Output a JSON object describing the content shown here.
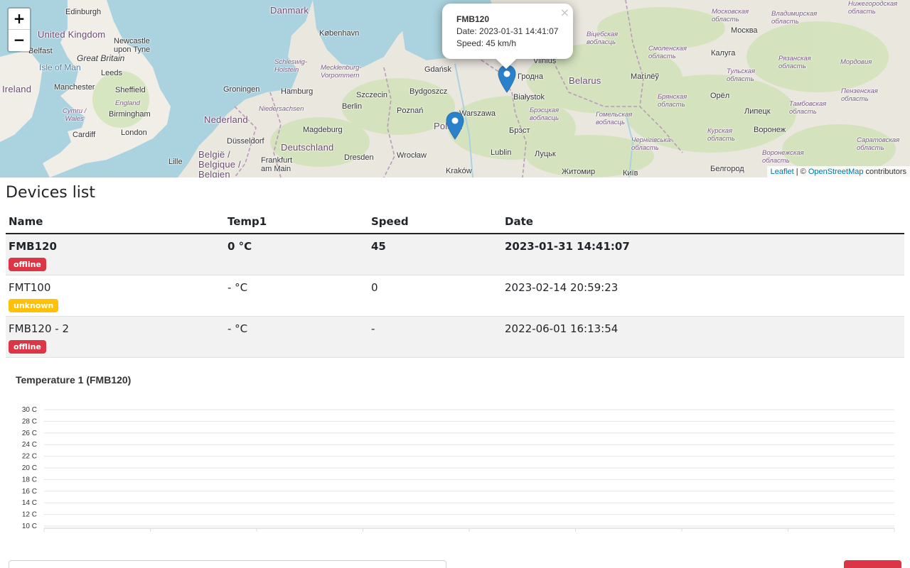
{
  "map": {
    "zoom_in": "+",
    "zoom_out": "−",
    "labels": {
      "edinburgh": "Edinburgh",
      "united_kingdom": "United Kingdom",
      "newcastle": "Newcastle\nupon Tyne",
      "belfast": "Belfast",
      "great_britain": "Great Britain",
      "isle_of_man": "Isle of Man",
      "leeds": "Leeds",
      "ireland": "Ireland",
      "manchester": "Manchester",
      "sheffield": "Sheffield",
      "cymru": "Cymru /\nWales",
      "england": "England",
      "birmingham": "Birmingham",
      "cardiff": "Cardiff",
      "london": "London",
      "lille": "Lille",
      "belgie": "België /\nBelgique /\nBelgien",
      "danmark": "Danmark",
      "kobenhavn": "København",
      "schleswig": "Schleswig-\nHolstein",
      "mecklenburg": "Mecklenburg-\nVorpommern",
      "groningen": "Groningen",
      "hamburg": "Hamburg",
      "szczecin": "Szczecin",
      "niedersachsen": "Niedersachsen",
      "berlin": "Berlin",
      "nederland": "Nederland",
      "magdeburg": "Magdeburg",
      "dusseldorf": "Düsseldorf",
      "deutschland": "Deutschland",
      "frankfurt": "Frankfurt\nam Main",
      "dresden": "Dresden",
      "gdansk": "Gdańsk",
      "bydgoszcz": "Bydgoszcz",
      "poznan": "Poznań",
      "warszawa": "Warszawa",
      "polska": "Polska",
      "wroclaw": "Wrocław",
      "krakow": "Kraków",
      "lublin": "Lublin",
      "vilnius": "Vilnius",
      "grodna": "Гродна",
      "bialystok": "Białystok",
      "belarus": "Belarus",
      "brest": "Брэст",
      "brestskaya": "Брэсцкая\nвобласць",
      "lutsk": "Луцьк",
      "zhytomyr": "Житомир",
      "kyiv": "Київ",
      "vitebsk": "Віцебская\nвобласць",
      "mahilyow": "Магілёў",
      "gomel": "Гомельская\nвобласць",
      "chernihiv": "Чернігівська\nобласть",
      "smolensk": "Смоленская\nобласть",
      "moskva": "Москва",
      "kaluga": "Калуга",
      "orel": "Орёл",
      "lipetsk": "Липецк",
      "voronezh": "Воронеж",
      "bryansk": "Брянская\nобласть",
      "kursk": "Курская\nобласть",
      "tula": "Тульская\nобласть",
      "ryazan": "Рязанская\nобласть",
      "tambov": "Тамбовская\nобласть",
      "penza": "Пензенская\nобласть",
      "vladimir": "Владимирская\nобласть",
      "nizhegorod": "Нижегородская\nобласть",
      "mordovia": "Мордовия",
      "voronezh_obl": "Воронежская\nобласть",
      "saratov": "Саратовская\nобласть",
      "belgorod": "Белгород",
      "moskovskaya": "Московская\nобласть"
    },
    "popup": {
      "name": "FMB120",
      "date_line": "Date: 2023-01-31 14:41:07",
      "speed_line": "Speed: 45 km/h",
      "close": "×"
    },
    "attribution": {
      "leaflet": "Leaflet",
      "sep": " | © ",
      "osm": "OpenStreetMap",
      "suffix": " contributors"
    },
    "marker_color": "#2a81cb"
  },
  "devices": {
    "title": "Devices list",
    "columns": [
      "Name",
      "Temp1",
      "Speed",
      "Date"
    ],
    "rows": [
      {
        "name": "FMB120",
        "temp": "0 °C",
        "speed": "45",
        "date": "2023-01-31 14:41:07",
        "status": "offline"
      },
      {
        "name": "FMT100",
        "temp": "- °C",
        "speed": "0",
        "date": "2023-02-14 20:59:23",
        "status": "unknown"
      },
      {
        "name": "FMB120 - 2",
        "temp": "- °C",
        "speed": "-",
        "date": "2022-06-01 16:13:54",
        "status": "offline"
      }
    ]
  },
  "chart_title": "Temperature 1 (FMB120)",
  "chart_data": {
    "type": "line",
    "title": "Temperature 1 (FMB120)",
    "y_ticks": [
      "30 C",
      "28 C",
      "26 C",
      "24 C",
      "22 C",
      "20 C",
      "18 C",
      "16 C",
      "14 C",
      "12 C",
      "10 C"
    ],
    "ylim": [
      10,
      30
    ],
    "grid": true,
    "series": []
  },
  "colors": {
    "offline": "#dc3545",
    "unknown": "#ffc107",
    "accent": "#2a81cb"
  }
}
